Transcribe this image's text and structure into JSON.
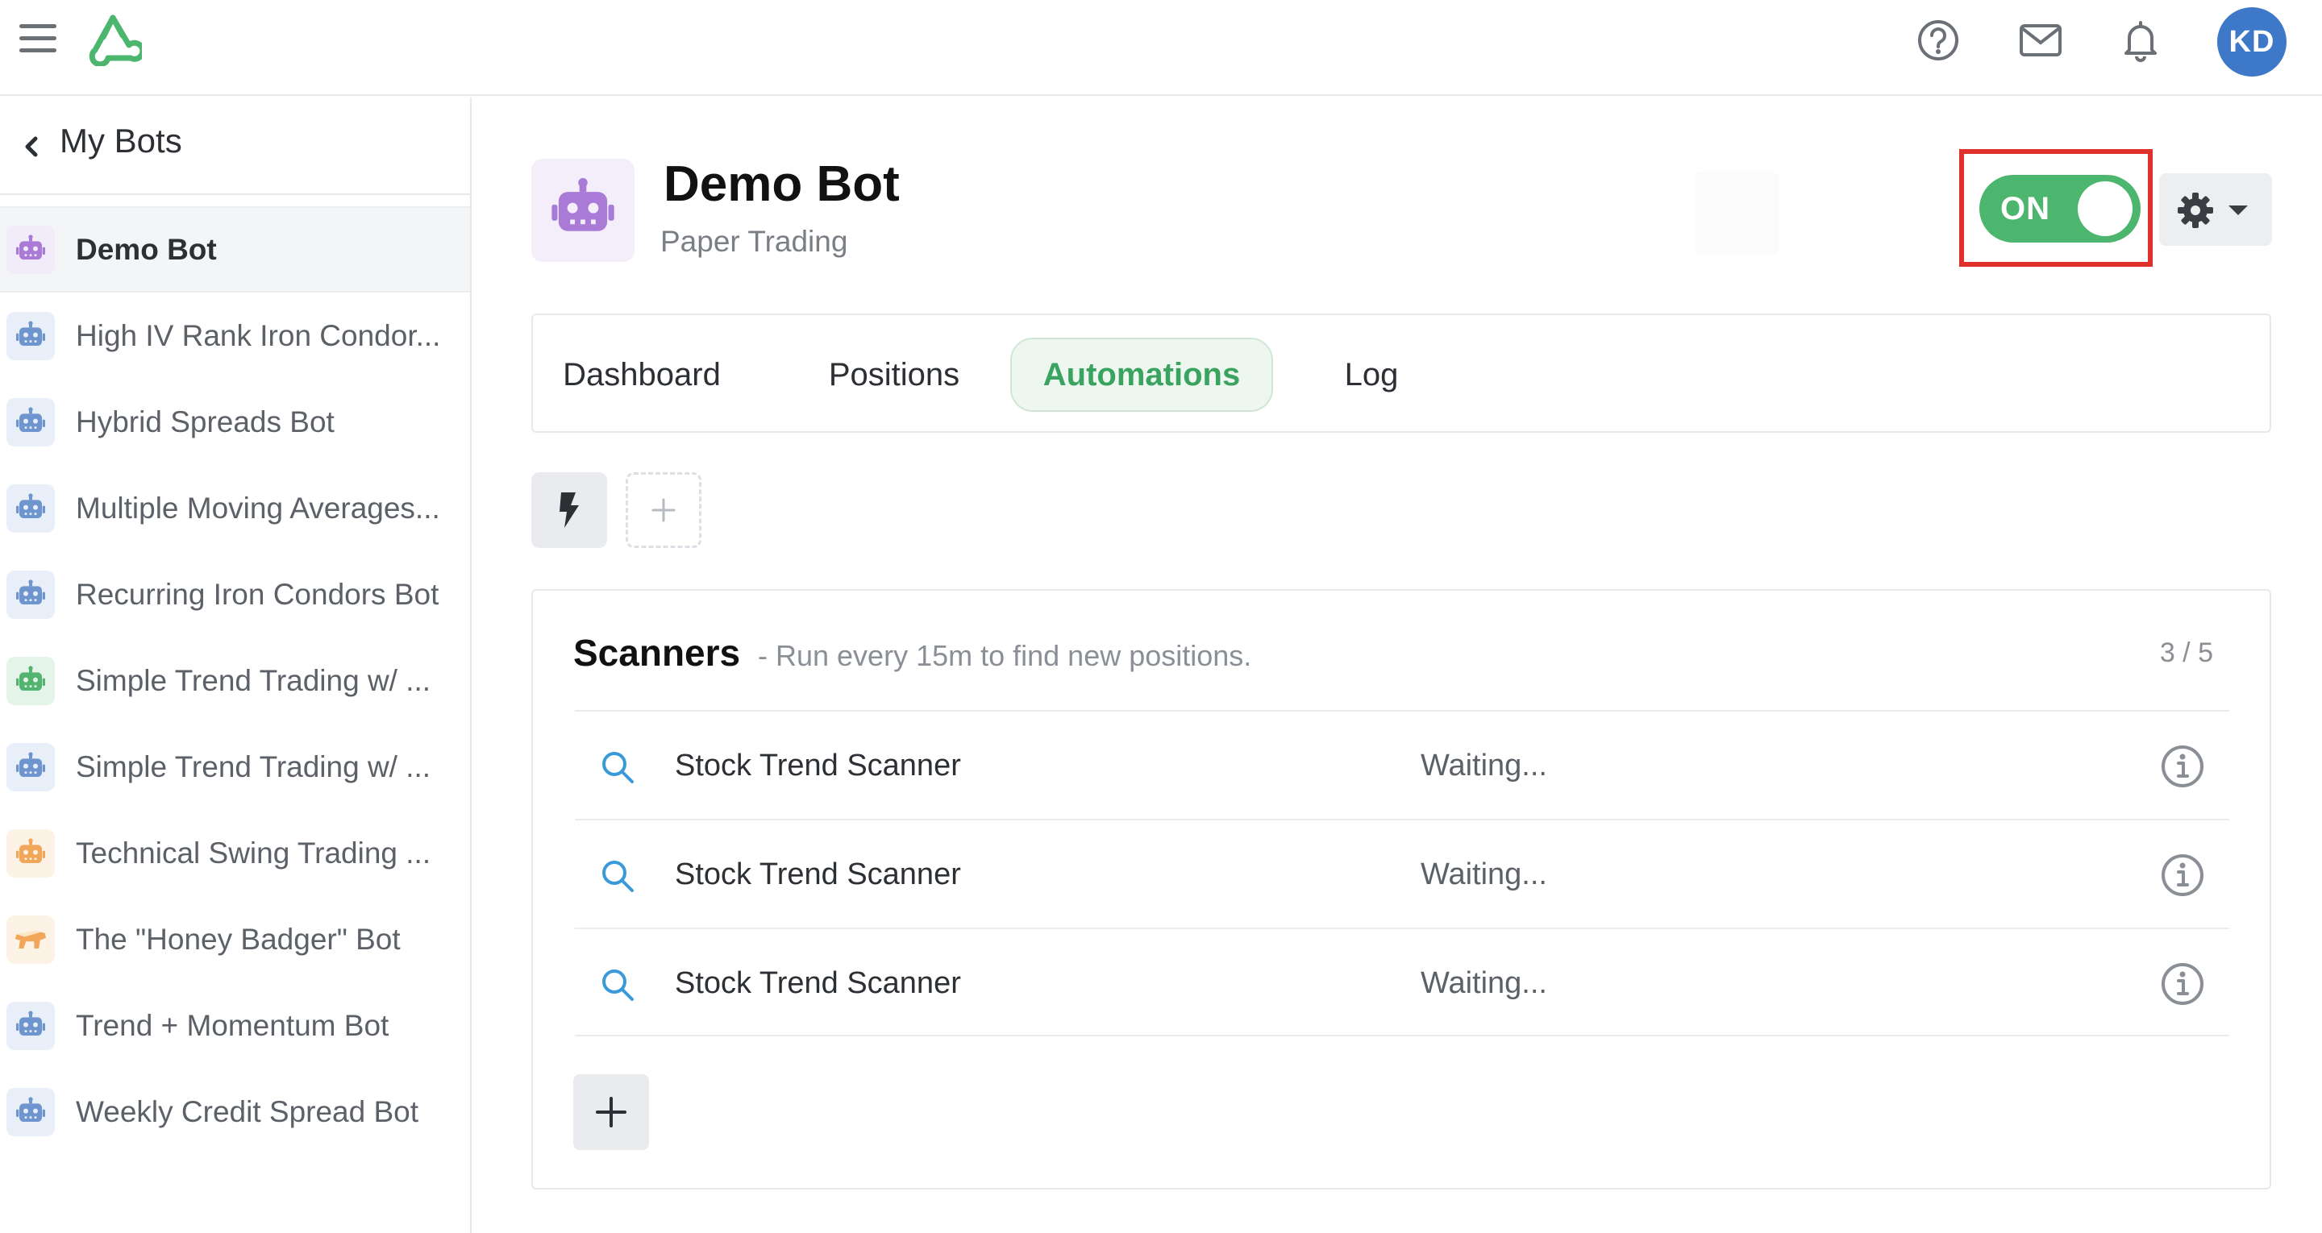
{
  "colors": {
    "brand_green": "#4cb56e",
    "active_tab_text": "#3aa35f",
    "highlight_red": "#e0302c",
    "avatar_blue": "#3e78c9"
  },
  "topbar": {
    "menu_icon": "hamburger-menu-icon",
    "logo_icon": "brand-logo-icon",
    "help_icon": "help-circle-icon",
    "mail_icon": "mail-icon",
    "bell_icon": "bell-icon",
    "avatar_initials": "KD"
  },
  "sidebar": {
    "back_label": "My Bots",
    "items": [
      {
        "label": "Demo Bot",
        "icon": "robot-icon",
        "color": "#a97bd6",
        "active": true
      },
      {
        "label": "High IV Rank Iron Condor...",
        "icon": "robot-icon",
        "color": "#6f95cf",
        "active": false
      },
      {
        "label": "Hybrid Spreads Bot",
        "icon": "robot-icon",
        "color": "#6f95cf",
        "active": false
      },
      {
        "label": "Multiple Moving Averages...",
        "icon": "robot-icon",
        "color": "#6f95cf",
        "active": false
      },
      {
        "label": "Recurring Iron Condors Bot",
        "icon": "robot-icon",
        "color": "#6f95cf",
        "active": false
      },
      {
        "label": "Simple Trend Trading w/ ...",
        "icon": "robot-icon",
        "color": "#52b46e",
        "active": false
      },
      {
        "label": "Simple Trend Trading w/ ...",
        "icon": "robot-icon",
        "color": "#6f95cf",
        "active": false
      },
      {
        "label": "Technical Swing Trading ...",
        "icon": "robot-icon",
        "color": "#f2a65a",
        "active": false
      },
      {
        "label": "The \"Honey Badger\" Bot",
        "icon": "honey-badger-icon",
        "color": "#f2a65a",
        "active": false
      },
      {
        "label": "Trend + Momentum Bot",
        "icon": "robot-icon",
        "color": "#6f95cf",
        "active": false
      },
      {
        "label": "Weekly Credit Spread Bot",
        "icon": "robot-icon",
        "color": "#6f95cf",
        "active": false
      }
    ]
  },
  "bot": {
    "name": "Demo Bot",
    "subtitle": "Paper Trading",
    "toggle_label": "ON",
    "toggle_state": true,
    "settings_icon": "gear-icon"
  },
  "tabs": [
    {
      "label": "Dashboard",
      "active": false
    },
    {
      "label": "Positions",
      "active": false
    },
    {
      "label": "Automations",
      "active": true
    },
    {
      "label": "Log",
      "active": false
    }
  ],
  "automation_toolbar": {
    "bolt_icon": "lightning-bolt-icon",
    "add_icon": "plus-icon"
  },
  "scanners": {
    "title": "Scanners",
    "description": "- Run every 15m to find new positions.",
    "count": "3 / 5",
    "rows": [
      {
        "name": "Stock Trend Scanner",
        "status": "Waiting..."
      },
      {
        "name": "Stock Trend Scanner",
        "status": "Waiting..."
      },
      {
        "name": "Stock Trend Scanner",
        "status": "Waiting..."
      }
    ]
  }
}
